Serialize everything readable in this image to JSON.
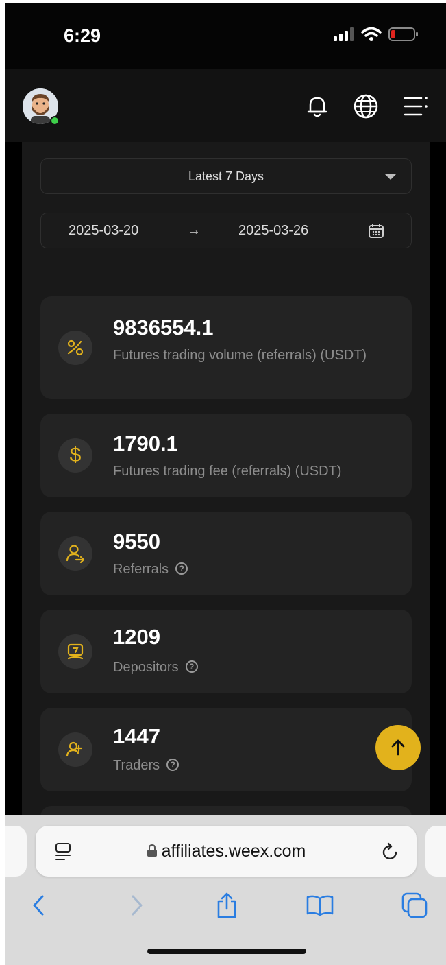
{
  "status_bar": {
    "time": "6:29"
  },
  "filter": {
    "period_label": "Latest 7 Days",
    "start_date": "2025-03-20",
    "arrow": "→",
    "end_date": "2025-03-26"
  },
  "stats": [
    {
      "value": "9836554.1",
      "label": "Futures trading volume (referrals) (USDT)",
      "icon": "percent-icon"
    },
    {
      "value": "1790.1",
      "label": "Futures trading fee (referrals) (USDT)",
      "icon": "dollar-icon"
    },
    {
      "value": "9550",
      "label": "Referrals",
      "icon": "user-arrow-icon"
    },
    {
      "value": "1209",
      "label": "Depositors",
      "icon": "deposit-icon"
    },
    {
      "value": "1447",
      "label": "Traders",
      "icon": "user-add-icon"
    }
  ],
  "browser": {
    "url": "affiliates.weex.com"
  },
  "colors": {
    "accent": "#e2b21c",
    "card": "#232323",
    "background": "#191919",
    "online": "#3ecf4a"
  }
}
